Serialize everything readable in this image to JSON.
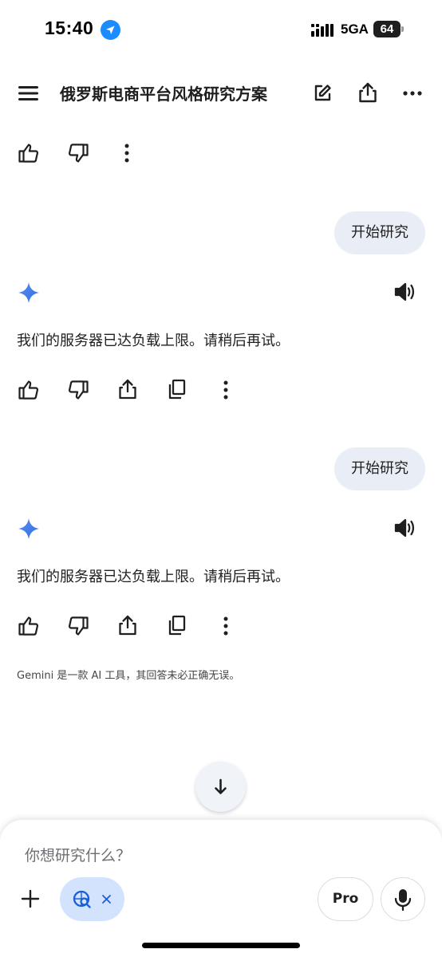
{
  "status_bar": {
    "time": "15:40",
    "network": "5GA",
    "battery": "64"
  },
  "header": {
    "title": "俄罗斯电商平台风格研究方案",
    "icons": [
      "menu-icon",
      "edit-icon",
      "share-icon",
      "more-icon"
    ]
  },
  "messages": [
    {
      "role": "user",
      "text": "开始研究"
    },
    {
      "role": "model",
      "text": "我们的服务器已达负载上限。请稍后再试。"
    },
    {
      "role": "user",
      "text": "开始研究"
    },
    {
      "role": "model",
      "text": "我们的服务器已达负载上限。请稍后再试。"
    }
  ],
  "disclaimer": "Gemini 是一款 AI 工具，其回答未必正确无误。",
  "composer": {
    "placeholder": "你想研究什么？",
    "pro_label": "Pro"
  },
  "colors": {
    "accent": "#1a73e8",
    "bubble": "#e9eef6",
    "chip": "#d3e3fd"
  }
}
